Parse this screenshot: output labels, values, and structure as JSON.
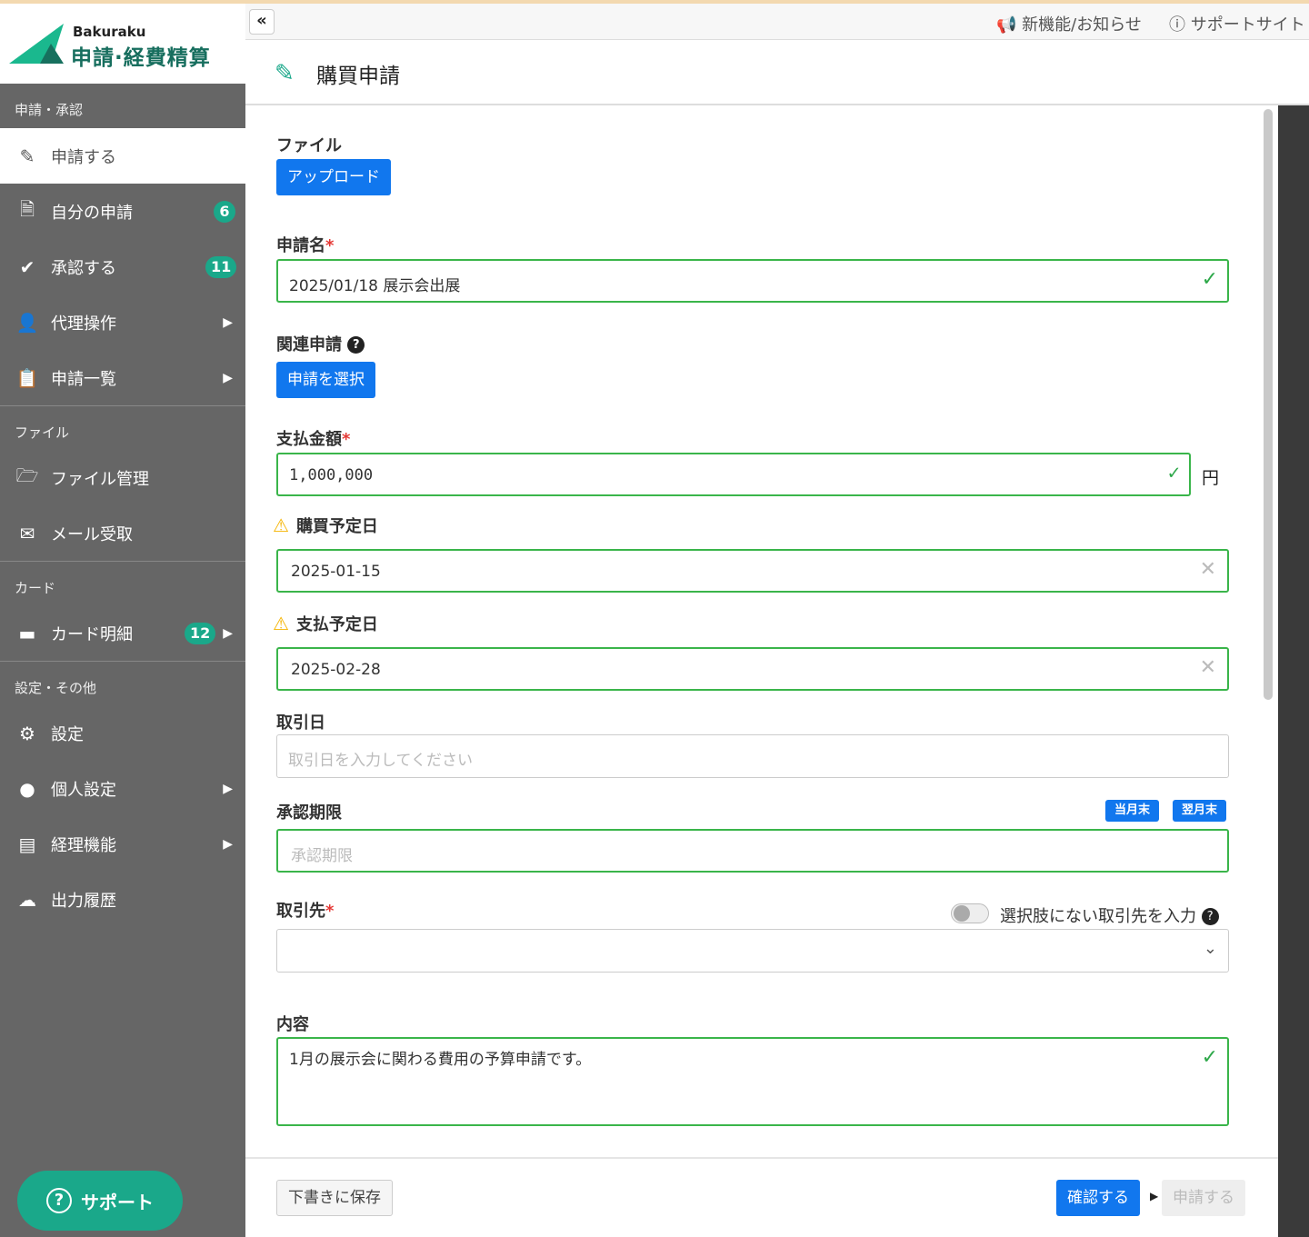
{
  "brand": {
    "sub": "Bakuraku",
    "title": "申請·経費精算"
  },
  "sidebar": {
    "sections": [
      "申請・承認",
      "ファイル",
      "カード",
      "設定・その他"
    ],
    "items": [
      {
        "label": "申請する",
        "icon": "edit-icon"
      },
      {
        "label": "自分の申請",
        "badge": "6",
        "icon": "document-icon"
      },
      {
        "label": "承認する",
        "badge": "11",
        "icon": "check-circle-icon"
      },
      {
        "label": "代理操作",
        "icon": "user-edit-icon"
      },
      {
        "label": "申請一覧",
        "icon": "clipboard-icon"
      },
      {
        "label": "ファイル管理",
        "icon": "folder-icon"
      },
      {
        "label": "メール受取",
        "icon": "mail-icon"
      },
      {
        "label": "カード明細",
        "badge": "12",
        "icon": "card-icon"
      },
      {
        "label": "設定",
        "icon": "gear-icon"
      },
      {
        "label": "個人設定",
        "icon": "user-circle-icon"
      },
      {
        "label": "経理機能",
        "icon": "receipt-icon"
      },
      {
        "label": "出力履歴",
        "icon": "cloud-download-icon"
      }
    ],
    "support": "サポート"
  },
  "topbar": {
    "news": "新機能/お知らせ",
    "support_site": "サポートサイト"
  },
  "header": {
    "title": "購買申請"
  },
  "form": {
    "file_label": "ファイル",
    "upload": "アップロード",
    "name_label": "申請名",
    "name_value": "2025/01/18 展示会出展",
    "related_label": "関連申請",
    "related_button": "申請を選択",
    "amount_label": "支払金額",
    "amount_value": "1,000,000",
    "currency": "円",
    "purchase_date_label": "購買予定日",
    "purchase_date_value": "2025-01-15",
    "payment_date_label": "支払予定日",
    "payment_date_value": "2025-02-28",
    "trade_date_label": "取引日",
    "trade_date_placeholder": "取引日を入力してください",
    "deadline_label": "承認期限",
    "deadline_placeholder": "承認期限",
    "this_month_end": "当月末",
    "next_month_end": "翌月末",
    "partner_label": "取引先",
    "partner_toggle": "選択肢にない取引先を入力",
    "content_label": "内容",
    "content_value": "1月の展示会に関わる費用の予算申請です。"
  },
  "footer": {
    "draft": "下書きに保存",
    "confirm": "確認する",
    "submit": "申請する"
  },
  "colors": {
    "brand": "#1aa88a",
    "primary": "#1177ee",
    "valid": "#3ab54a"
  }
}
